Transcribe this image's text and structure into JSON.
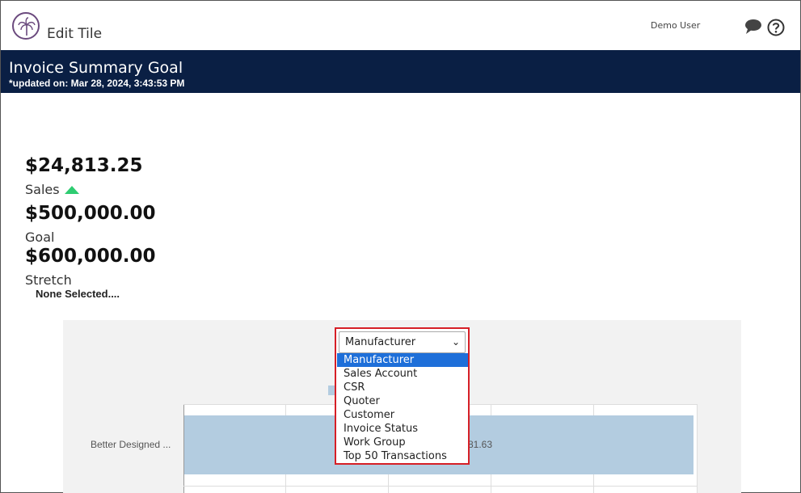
{
  "header": {
    "title": "Edit Tile",
    "user": "Demo User"
  },
  "tile": {
    "title": "Invoice Summary Goal",
    "updated": "*updated on: Mar 28, 2024, 3:43:53 PM"
  },
  "metrics": [
    {
      "value": "$24,813.25",
      "label": "Sales",
      "trend": "up"
    },
    {
      "value": "$500,000.00",
      "label": "Goal"
    },
    {
      "value": "$600,000.00",
      "label": "Stretch"
    }
  ],
  "selection_text": "None Selected....",
  "dropdown": {
    "selected": "Manufacturer",
    "options": [
      "Manufacturer",
      "Sales Account",
      "CSR",
      "Quoter",
      "Customer",
      "Invoice Status",
      "Work Group",
      "Top 50 Transactions"
    ]
  },
  "chart": {
    "category": "Better Designed ...",
    "value_label": "81.63",
    "bar_fraction": 1.0
  },
  "colors": {
    "header_bg": "#0a1f44",
    "accent_red": "#d61f26",
    "bar": "#b3cce0",
    "up_arrow": "#2ecc71",
    "selected_option": "#1e6fd9"
  }
}
